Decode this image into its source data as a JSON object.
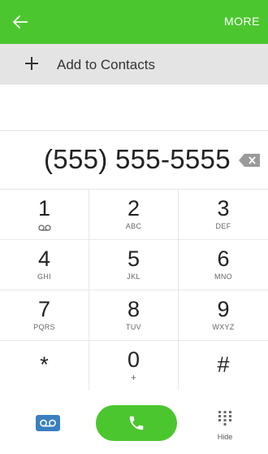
{
  "header": {
    "back_icon": "arrow-left-icon",
    "more_label": "MORE",
    "background_color": "#4cc62f"
  },
  "add_contact": {
    "icon": "plus-icon",
    "label": "Add to Contacts"
  },
  "dialed_number": "(555) 555-5555",
  "backspace_icon": "backspace-icon",
  "keypad": {
    "keys": [
      {
        "digit": "1",
        "letters": "",
        "sub_icon": "voicemail-icon"
      },
      {
        "digit": "2",
        "letters": "ABC"
      },
      {
        "digit": "3",
        "letters": "DEF"
      },
      {
        "digit": "4",
        "letters": "GHI"
      },
      {
        "digit": "5",
        "letters": "JKL"
      },
      {
        "digit": "6",
        "letters": "MNO"
      },
      {
        "digit": "7",
        "letters": "PQRS"
      },
      {
        "digit": "8",
        "letters": "TUV"
      },
      {
        "digit": "9",
        "letters": "WXYZ"
      },
      {
        "digit": "*",
        "letters": ""
      },
      {
        "digit": "0",
        "letters": "+"
      },
      {
        "digit": "#",
        "letters": ""
      }
    ]
  },
  "bottom_bar": {
    "voicemail_icon": "voicemail-icon",
    "call_icon": "phone-icon",
    "call_color": "#4cc62f",
    "hide_icon": "dialpad-icon",
    "hide_label": "Hide"
  }
}
